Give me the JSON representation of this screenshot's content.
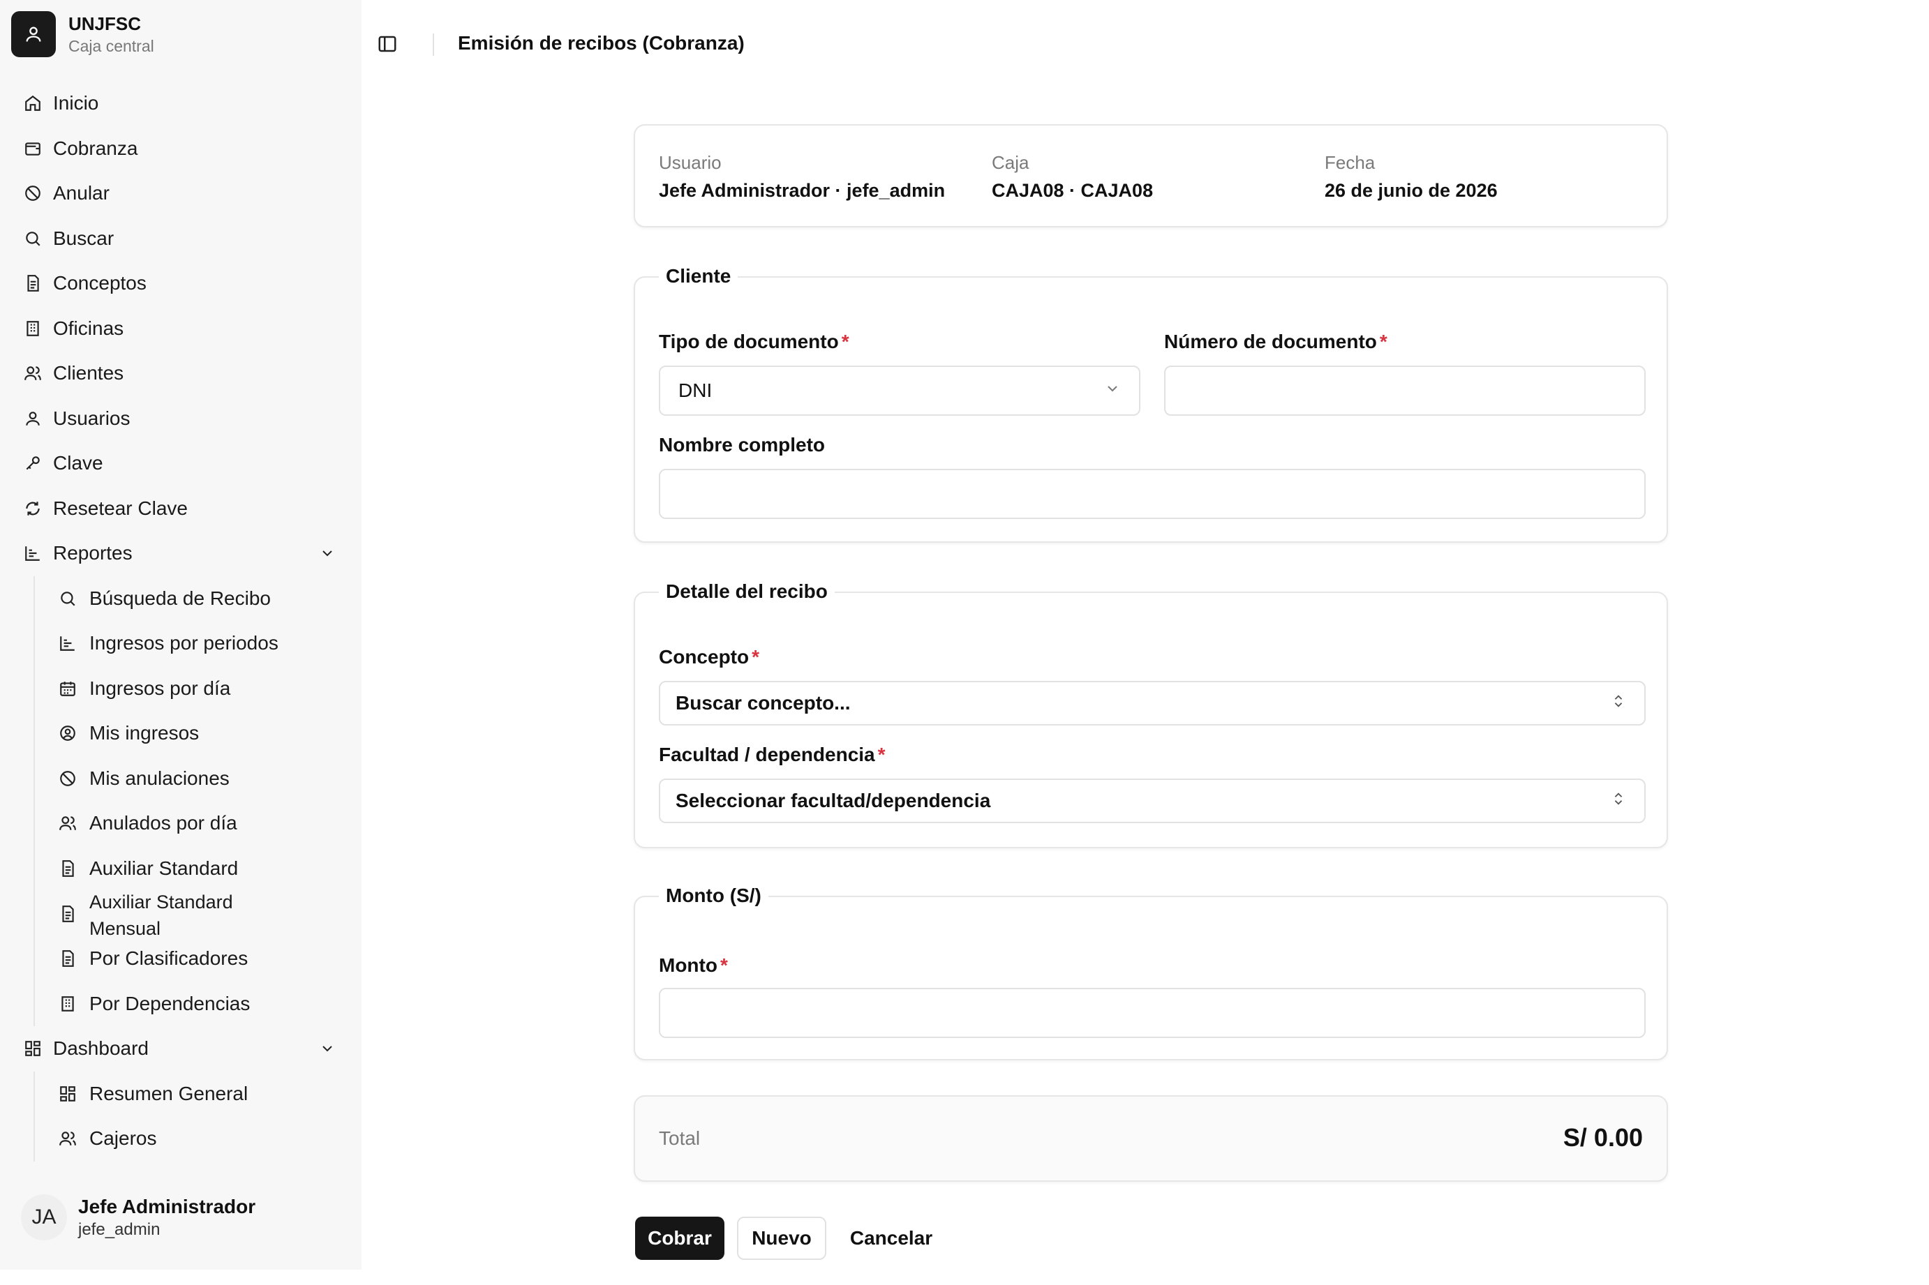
{
  "brand": {
    "name": "UNJFSC",
    "subtitle": "Caja central",
    "logo_icon": "user-icon"
  },
  "sidebar": {
    "items": [
      {
        "label": "Inicio",
        "icon": "home-icon"
      },
      {
        "label": "Cobranza",
        "icon": "wallet-icon"
      },
      {
        "label": "Anular",
        "icon": "ban-icon"
      },
      {
        "label": "Buscar",
        "icon": "search-icon"
      },
      {
        "label": "Conceptos",
        "icon": "file-text-icon"
      },
      {
        "label": "Oficinas",
        "icon": "building-icon"
      },
      {
        "label": "Clientes",
        "icon": "users-icon"
      },
      {
        "label": "Usuarios",
        "icon": "user-icon"
      },
      {
        "label": "Clave",
        "icon": "key-icon"
      },
      {
        "label": "Resetear Clave",
        "icon": "refresh-icon"
      }
    ],
    "reportes": {
      "label": "Reportes",
      "icon": "chart-icon",
      "items": [
        {
          "label": "Búsqueda de Recibo",
          "icon": "search-icon"
        },
        {
          "label": "Ingresos por periodos",
          "icon": "chart-icon"
        },
        {
          "label": "Ingresos por día",
          "icon": "calendar-icon"
        },
        {
          "label": "Mis ingresos",
          "icon": "user-circle-icon"
        },
        {
          "label": "Mis anulaciones",
          "icon": "ban-icon"
        },
        {
          "label": "Anulados por día",
          "icon": "users-icon"
        },
        {
          "label": "Auxiliar Standard",
          "icon": "file-text-icon"
        },
        {
          "label": "Auxiliar Standard Mensual",
          "icon": "file-text-icon"
        },
        {
          "label": "Por Clasificadores",
          "icon": "file-text-icon"
        },
        {
          "label": "Por Dependencias",
          "icon": "building-icon"
        }
      ]
    },
    "dashboard": {
      "label": "Dashboard",
      "icon": "dashboard-icon",
      "items": [
        {
          "label": "Resumen General",
          "icon": "dashboard-icon"
        },
        {
          "label": "Cajeros",
          "icon": "users-icon"
        }
      ]
    }
  },
  "user": {
    "initials": "JA",
    "name": "Jefe Administrador",
    "login": "jefe_admin"
  },
  "header": {
    "title": "Emisión de recibos (Cobranza)"
  },
  "info": {
    "usuario_label": "Usuario",
    "usuario_value": "Jefe Administrador · jefe_admin",
    "caja_label": "Caja",
    "caja_value": "CAJA08 · CAJA08",
    "fecha_label": "Fecha",
    "fecha_value": "26 de junio de 2026"
  },
  "cliente": {
    "legend": "Cliente",
    "tipo_label": "Tipo de documento",
    "tipo_value": "DNI",
    "numero_label": "Número de documento",
    "numero_value": "",
    "nombre_label": "Nombre completo",
    "nombre_value": ""
  },
  "detalle": {
    "legend": "Detalle del recibo",
    "concepto_label": "Concepto",
    "concepto_placeholder": "Buscar concepto...",
    "facultad_label": "Facultad / dependencia",
    "facultad_placeholder": "Seleccionar facultad/dependencia"
  },
  "monto": {
    "legend": "Monto (S/)",
    "label": "Monto",
    "value": ""
  },
  "total": {
    "label": "Total",
    "value": "S/ 0.00"
  },
  "actions": {
    "cobrar": "Cobrar",
    "nuevo": "Nuevo",
    "cancelar": "Cancelar"
  },
  "required_mark": "*"
}
